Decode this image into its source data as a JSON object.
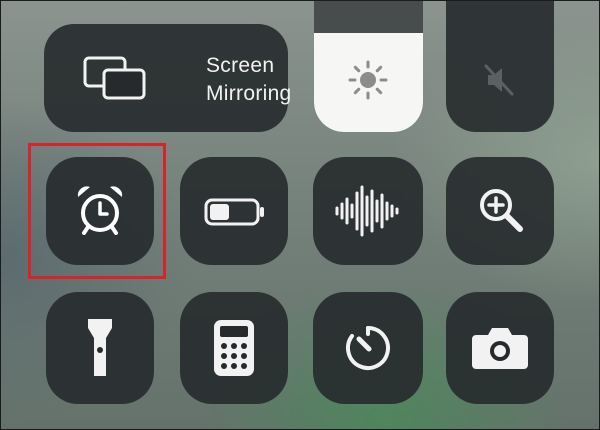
{
  "control_center": {
    "screen_mirroring": {
      "label_line1": "Screen",
      "label_line2": "Mirroring",
      "icon": "screen-mirroring-icon"
    },
    "brightness": {
      "icon": "sun-icon",
      "level_percent": 65
    },
    "volume": {
      "icon": "speaker-muted-icon",
      "level_percent": 0
    },
    "tiles": [
      {
        "id": "alarm",
        "icon": "alarm-clock-icon"
      },
      {
        "id": "low-power-mode",
        "icon": "battery-icon"
      },
      {
        "id": "voice-memos",
        "icon": "waveform-icon"
      },
      {
        "id": "magnifier",
        "icon": "magnifier-icon"
      },
      {
        "id": "flashlight",
        "icon": "flashlight-icon"
      },
      {
        "id": "calculator",
        "icon": "calculator-icon"
      },
      {
        "id": "timer",
        "icon": "timer-icon"
      },
      {
        "id": "camera",
        "icon": "camera-icon"
      }
    ]
  },
  "annotation": {
    "highlight_target": "alarm",
    "color": "#d7242a"
  }
}
